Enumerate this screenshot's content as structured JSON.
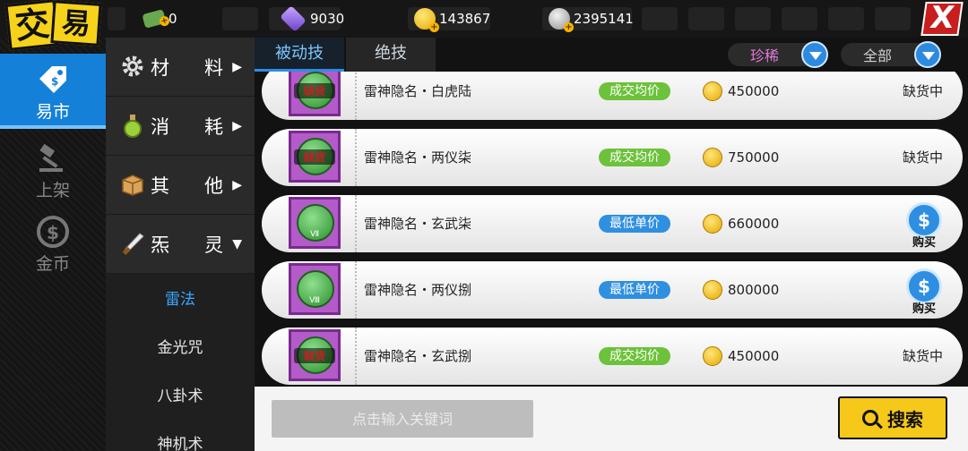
{
  "header": {
    "logo_chars": [
      "交",
      "易"
    ],
    "currencies": [
      {
        "icon": "cash-icon",
        "value": "0"
      },
      {
        "icon": "gem-icon",
        "value": "9030"
      },
      {
        "icon": "gold-coin-icon",
        "value": "143867"
      },
      {
        "icon": "silver-coin-icon",
        "value": "2395141"
      }
    ],
    "close_label": "X"
  },
  "leftnav": {
    "items": [
      {
        "label": "易市",
        "icon": "price-tag-icon",
        "active": true
      },
      {
        "label": "上架",
        "icon": "gavel-icon",
        "active": false
      },
      {
        "label": "金币",
        "icon": "dollar-coin-icon",
        "active": false
      }
    ]
  },
  "categories": {
    "items": [
      {
        "c1": "材",
        "c2": "料",
        "arrow": "▶",
        "icon": "gear-icon"
      },
      {
        "c1": "消",
        "c2": "耗",
        "arrow": "▶",
        "icon": "potion-icon"
      },
      {
        "c1": "其",
        "c2": "他",
        "arrow": "▶",
        "icon": "box-icon"
      },
      {
        "c1": "炁",
        "c2": "灵",
        "arrow": "▼",
        "icon": "blade-icon"
      }
    ],
    "subitems": [
      {
        "label": "雷法",
        "active": true
      },
      {
        "label": "金光咒",
        "active": false
      },
      {
        "label": "八卦术",
        "active": false
      },
      {
        "label": "神机术",
        "active": false
      }
    ]
  },
  "tabs": [
    {
      "label": "被动技",
      "active": true
    },
    {
      "label": "绝技",
      "active": false
    }
  ],
  "filters": {
    "rarity": "珍稀",
    "scope": "全部"
  },
  "accent_colors": {
    "blue": "#2d8de5",
    "green": "#6cc23a",
    "yellow": "#f6c81a",
    "purple": "#b35bc9"
  },
  "listings": [
    {
      "name": "雷神隐名・白虎陆",
      "sold_out_badge": "缺货",
      "price_tag": "成交均价",
      "tag_color": "green",
      "price": "450000",
      "status": "缺货中",
      "action": null
    },
    {
      "name": "雷神隐名・两仪柒",
      "sold_out_badge": "缺货",
      "price_tag": "成交均价",
      "tag_color": "green",
      "price": "750000",
      "status": "缺货中",
      "action": null
    },
    {
      "name": "雷神隐名・玄武柒",
      "sold_out_badge": null,
      "price_tag": "最低单价",
      "tag_color": "blue",
      "price": "660000",
      "status": null,
      "action": "购买",
      "roman": "Ⅶ"
    },
    {
      "name": "雷神隐名・两仪捌",
      "sold_out_badge": null,
      "price_tag": "最低单价",
      "tag_color": "blue",
      "price": "800000",
      "status": null,
      "action": "购买",
      "roman": "Ⅷ"
    },
    {
      "name": "雷神隐名・玄武捌",
      "sold_out_badge": "缺货",
      "price_tag": "成交均价",
      "tag_color": "green",
      "price": "450000",
      "status": "缺货中",
      "action": null
    }
  ],
  "search": {
    "placeholder": "点击输入关键词",
    "button_label": "搜索"
  }
}
